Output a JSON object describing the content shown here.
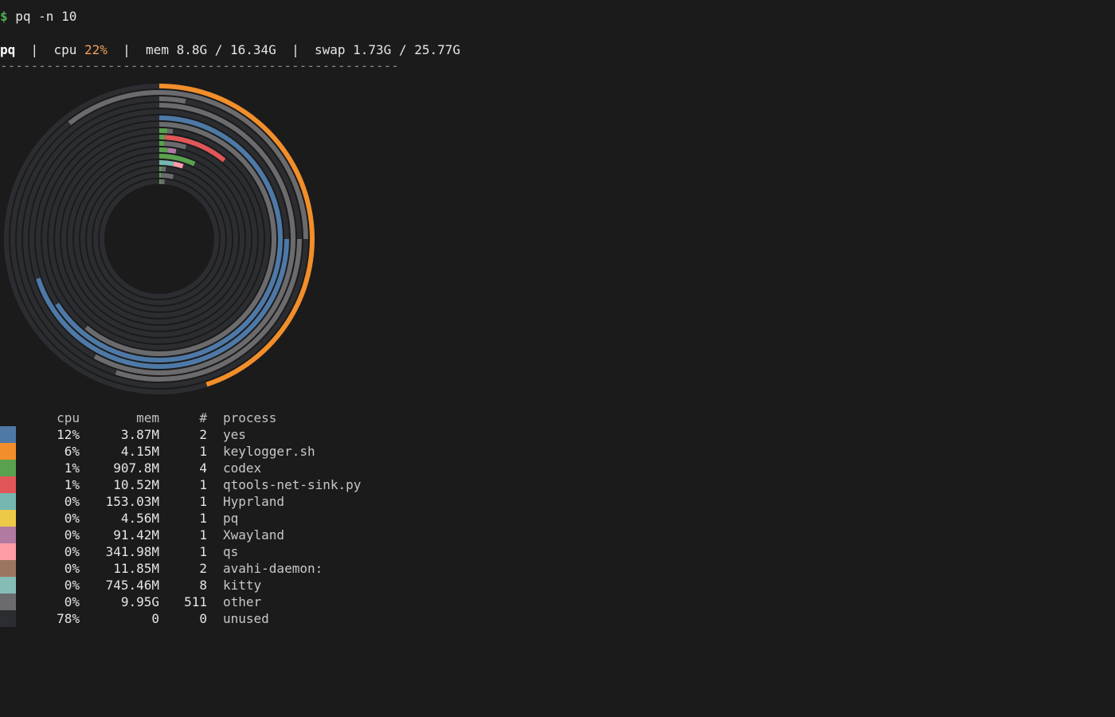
{
  "prompt": {
    "symbol": "$",
    "command": " pq -n 10"
  },
  "status": {
    "app": "pq",
    "sep": "  |  ",
    "cpu_label": "cpu ",
    "cpu_value": "22%",
    "mem_text": "mem 8.8G / 16.34G",
    "swap_text": "swap 1.73G / 25.77G"
  },
  "rule": "----------------------------------------------------",
  "table": {
    "headers": {
      "cpu": "cpu",
      "mem": "mem",
      "count": "#",
      "process": "process"
    },
    "rows": [
      {
        "color": "#4e79a7",
        "cpu": "12%",
        "mem": "3.87M",
        "count": "2",
        "process": "yes"
      },
      {
        "color": "#f28e2b",
        "cpu": "6%",
        "mem": "4.15M",
        "count": "1",
        "process": "keylogger.sh"
      },
      {
        "color": "#59a14f",
        "cpu": "1%",
        "mem": "907.8M",
        "count": "4",
        "process": "codex"
      },
      {
        "color": "#e15759",
        "cpu": "1%",
        "mem": "10.52M",
        "count": "1",
        "process": "qtools-net-sink.py"
      },
      {
        "color": "#76b7b2",
        "cpu": "0%",
        "mem": "153.03M",
        "count": "1",
        "process": "Hyprland"
      },
      {
        "color": "#edc948",
        "cpu": "0%",
        "mem": "4.56M",
        "count": "1",
        "process": "pq"
      },
      {
        "color": "#b07aa1",
        "cpu": "0%",
        "mem": "91.42M",
        "count": "1",
        "process": "Xwayland"
      },
      {
        "color": "#ff9da7",
        "cpu": "0%",
        "mem": "341.98M",
        "count": "1",
        "process": "qs"
      },
      {
        "color": "#9c755f",
        "cpu": "0%",
        "mem": "11.85M",
        "count": "2",
        "process": "avahi-daemon:"
      },
      {
        "color": "#86bcb6",
        "cpu": "0%",
        "mem": "745.46M",
        "count": "8",
        "process": "kitty"
      },
      {
        "color": "#6b6b6e",
        "cpu": "0%",
        "mem": "9.95G",
        "count": "511",
        "process": "other"
      },
      {
        "color": "#2c2d31",
        "cpu": "78%",
        "mem": "0",
        "count": "0",
        "process": "unused"
      }
    ]
  },
  "rings_chart": {
    "track_color": "#2c2d31",
    "rings": [
      {
        "segments": [
          {
            "start": 0.0,
            "end": 0.45,
            "color": "#f28e2b"
          },
          {
            "start": 0.45,
            "end": 1.0,
            "color": "#2c2d31"
          }
        ]
      },
      {
        "segments": [
          {
            "start": 0.0,
            "end": 0.25,
            "color": "#6b6b6e"
          },
          {
            "start": 0.25,
            "end": 0.895,
            "color": "#2c2d31"
          },
          {
            "start": 0.895,
            "end": 1.0,
            "color": "#6b6b6e"
          }
        ]
      },
      {
        "segments": [
          {
            "start": 0.0,
            "end": 0.03,
            "color": "#6b6b6e"
          },
          {
            "start": 0.03,
            "end": 0.25,
            "color": "#2c2d31"
          },
          {
            "start": 0.25,
            "end": 0.55,
            "color": "#6b6b6e"
          },
          {
            "start": 0.55,
            "end": 1.0,
            "color": "#2c2d31"
          }
        ]
      },
      {
        "segments": [
          {
            "start": 0.0,
            "end": 0.58,
            "color": "#6b6b6e"
          },
          {
            "start": 0.58,
            "end": 1.0,
            "color": "#2c2d31"
          }
        ]
      },
      {
        "segments": [
          {
            "start": 0.0,
            "end": 0.25,
            "color": "#2c2d31"
          },
          {
            "start": 0.25,
            "end": 0.7,
            "color": "#4e79a7"
          },
          {
            "start": 0.7,
            "end": 1.0,
            "color": "#2c2d31"
          }
        ]
      },
      {
        "segments": [
          {
            "start": 0.0,
            "end": 0.66,
            "color": "#4e79a7"
          },
          {
            "start": 0.66,
            "end": 1.0,
            "color": "#2c2d31"
          }
        ]
      },
      {
        "segments": [
          {
            "start": 0.0,
            "end": 0.61,
            "color": "#6b6b6e"
          },
          {
            "start": 0.61,
            "end": 1.0,
            "color": "#2c2d31"
          }
        ]
      },
      {
        "segments": [
          {
            "start": 0.0,
            "end": 0.012,
            "color": "#59a14f"
          },
          {
            "start": 0.012,
            "end": 0.02,
            "color": "#6b6b6e"
          },
          {
            "start": 0.02,
            "end": 1.0,
            "color": "#2c2d31"
          }
        ]
      },
      {
        "segments": [
          {
            "start": 0.0,
            "end": 0.009,
            "color": "#59a14f"
          },
          {
            "start": 0.009,
            "end": 0.11,
            "color": "#e15759"
          },
          {
            "start": 0.11,
            "end": 1.0,
            "color": "#2c2d31"
          }
        ]
      },
      {
        "segments": [
          {
            "start": 0.0,
            "end": 0.008,
            "color": "#59a14f"
          },
          {
            "start": 0.008,
            "end": 0.045,
            "color": "#6b6b6e"
          },
          {
            "start": 0.045,
            "end": 1.0,
            "color": "#2c2d31"
          }
        ]
      },
      {
        "segments": [
          {
            "start": 0.0,
            "end": 0.015,
            "color": "#59a14f"
          },
          {
            "start": 0.015,
            "end": 0.03,
            "color": "#b07aa1"
          },
          {
            "start": 0.03,
            "end": 1.0,
            "color": "#2c2d31"
          }
        ]
      },
      {
        "segments": [
          {
            "start": 0.0,
            "end": 0.07,
            "color": "#59a14f"
          },
          {
            "start": 0.07,
            "end": 1.0,
            "color": "#2c2d31"
          }
        ]
      },
      {
        "segments": [
          {
            "start": 0.0,
            "end": 0.03,
            "color": "#76b7b2"
          },
          {
            "start": 0.03,
            "end": 0.05,
            "color": "#ff9da7"
          },
          {
            "start": 0.05,
            "end": 1.0,
            "color": "#2c2d31"
          }
        ]
      },
      {
        "segments": [
          {
            "start": 0.0,
            "end": 0.005,
            "color": "#59a14f"
          },
          {
            "start": 0.005,
            "end": 0.015,
            "color": "#6b6b6e"
          },
          {
            "start": 0.015,
            "end": 1.0,
            "color": "#2c2d31"
          }
        ]
      },
      {
        "segments": [
          {
            "start": 0.0,
            "end": 0.004,
            "color": "#59a14f"
          },
          {
            "start": 0.004,
            "end": 0.035,
            "color": "#6b6b6e"
          },
          {
            "start": 0.035,
            "end": 1.0,
            "color": "#2c2d31"
          }
        ]
      },
      {
        "segments": [
          {
            "start": 0.0,
            "end": 0.004,
            "color": "#59a14f"
          },
          {
            "start": 0.004,
            "end": 0.015,
            "color": "#6b6b6e"
          },
          {
            "start": 0.015,
            "end": 1.0,
            "color": "#2c2d31"
          }
        ]
      }
    ]
  }
}
